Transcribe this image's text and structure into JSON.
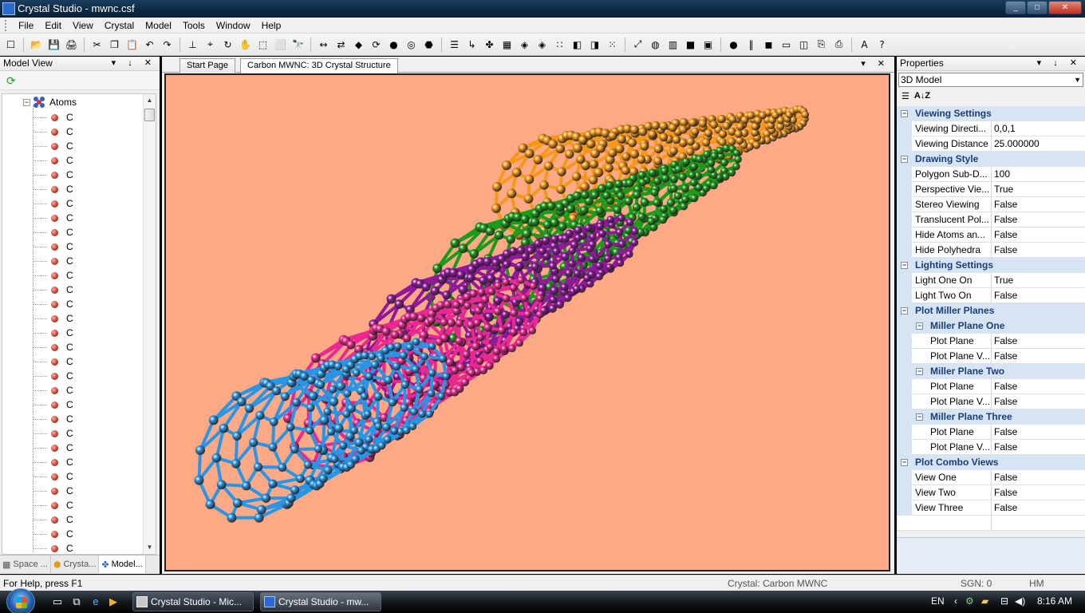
{
  "window": {
    "title": "Crystal Studio - mwnc.csf",
    "buttons": [
      "_",
      "□",
      "✕"
    ]
  },
  "menubar": {
    "items": [
      "File",
      "Edit",
      "View",
      "Crystal",
      "Model",
      "Tools",
      "Window",
      "Help"
    ]
  },
  "toolbar": {
    "icons": [
      "new-icon",
      "open-icon",
      "save-icon",
      "print-icon",
      "cut-icon",
      "copy-icon",
      "paste-icon",
      "undo-icon",
      "redo-icon",
      "axes-icon",
      "axes-label-icon",
      "rotate-icon",
      "pan-icon",
      "select-icon",
      "select-all-icon",
      "find-icon",
      "bond-icon",
      "bond-add-icon",
      "polyhedra-icon",
      "refresh-icon",
      "render-icon",
      "center-icon",
      "crystal-icon",
      "list-icon",
      "link-icon",
      "atoms-icon",
      "cell-icon",
      "color-icon",
      "color2-icon",
      "grid-icon",
      "plane-icon",
      "plane2-icon",
      "dots-icon",
      "fit-icon",
      "sphere-icon",
      "chart-icon",
      "black-icon",
      "frame-icon",
      "dot-icon",
      "pause-icon",
      "stop-icon",
      "window-icon",
      "preview-icon",
      "export-icon",
      "export2-icon",
      "font-icon",
      "help-icon"
    ],
    "glyphs": [
      "☐",
      "📂",
      "💾",
      "🖨",
      "✂",
      "❐",
      "📋",
      "↶",
      "↷",
      "⊥",
      "⌖",
      "↻",
      "✋",
      "⬚",
      "⬜",
      "🔭",
      "↔",
      "⇄",
      "◆",
      "⟳",
      "●",
      "◎",
      "⬣",
      "☰",
      "↳",
      "✤",
      "▦",
      "◈",
      "◈",
      "∷",
      "◧",
      "◨",
      "⁙",
      "⤢",
      "◍",
      "▥",
      "■",
      "▣",
      "●",
      "‖",
      "◼",
      "▭",
      "◫",
      "⎘",
      "⎙",
      "A",
      "?"
    ]
  },
  "model_view": {
    "title": "Model View",
    "header_buttons": "▾ ↓ ✕",
    "root_label": "Atoms",
    "items": [
      "C",
      "C",
      "C",
      "C",
      "C",
      "C",
      "C",
      "C",
      "C",
      "C",
      "C",
      "C",
      "C",
      "C",
      "C",
      "C",
      "C",
      "C",
      "C",
      "C",
      "C",
      "C",
      "C",
      "C",
      "C",
      "C",
      "C",
      "C",
      "C",
      "C",
      "C"
    ],
    "bottom_tabs": [
      {
        "label": "Space ...",
        "icon": "▦"
      },
      {
        "label": "Crysta...",
        "icon": "⬢"
      },
      {
        "label": "Model...",
        "icon": "✤"
      }
    ]
  },
  "document": {
    "tabs": [
      "Start Page",
      "Carbon MWNC: 3D Crystal Structure"
    ],
    "header_buttons": "▾ ✕",
    "viewport_bg": "#fea985",
    "tube_colors": {
      "blue": "#2896e6",
      "pink": "#ec2890",
      "purple": "#90189a",
      "green": "#1c9a1c",
      "orange": "#f5981a"
    }
  },
  "properties": {
    "title": "Properties",
    "header_buttons": "▾ ↓ ✕",
    "selector": "3D Model",
    "tools": [
      "☰",
      "A↓Z"
    ],
    "rows": [
      {
        "type": "cat",
        "label": "Viewing Settings"
      },
      {
        "type": "item",
        "name": "Viewing Directi...",
        "value": "0,0,1"
      },
      {
        "type": "item",
        "name": "Viewing Distance",
        "value": "25.000000"
      },
      {
        "type": "cat",
        "label": "Drawing Style"
      },
      {
        "type": "item",
        "name": "Polygon Sub-D...",
        "value": "100"
      },
      {
        "type": "item",
        "name": "Perspective Vie...",
        "value": "True"
      },
      {
        "type": "item",
        "name": "Stereo Viewing",
        "value": "False"
      },
      {
        "type": "item",
        "name": "Translucent Pol...",
        "value": "False"
      },
      {
        "type": "item",
        "name": "Hide Atoms an...",
        "value": "False"
      },
      {
        "type": "item",
        "name": "Hide Polyhedra",
        "value": "False"
      },
      {
        "type": "cat",
        "label": "Lighting Settings"
      },
      {
        "type": "item",
        "name": "Light One On",
        "value": "True"
      },
      {
        "type": "item",
        "name": "Light Two On",
        "value": "False"
      },
      {
        "type": "cat",
        "label": "Plot Miller Planes"
      },
      {
        "type": "subcat",
        "label": "Miller Plane One"
      },
      {
        "type": "subitem",
        "name": "Plot Plane",
        "value": "False"
      },
      {
        "type": "subitem",
        "name": "Plot Plane V...",
        "value": "False"
      },
      {
        "type": "subcat",
        "label": "Miller Plane Two"
      },
      {
        "type": "subitem",
        "name": "Plot Plane",
        "value": "False"
      },
      {
        "type": "subitem",
        "name": "Plot Plane V...",
        "value": "False"
      },
      {
        "type": "subcat",
        "label": "Miller Plane Three"
      },
      {
        "type": "subitem",
        "name": "Plot Plane",
        "value": "False"
      },
      {
        "type": "subitem",
        "name": "Plot Plane V...",
        "value": "False"
      },
      {
        "type": "cat",
        "label": "Plot Combo Views"
      },
      {
        "type": "item",
        "name": "View One",
        "value": "False"
      },
      {
        "type": "item",
        "name": "View Two",
        "value": "False"
      },
      {
        "type": "item",
        "name": "View Three",
        "value": "False"
      }
    ]
  },
  "statusbar": {
    "help": "For Help, press F1",
    "crystal": "Crystal:  Carbon MWNC",
    "sgn": "SGN: 0",
    "mode": "HM"
  },
  "taskbar": {
    "tasks": [
      "Crystal Studio - Mic...",
      "Crystal Studio - mw..."
    ],
    "lang": "EN",
    "clock": "8:16 AM"
  }
}
